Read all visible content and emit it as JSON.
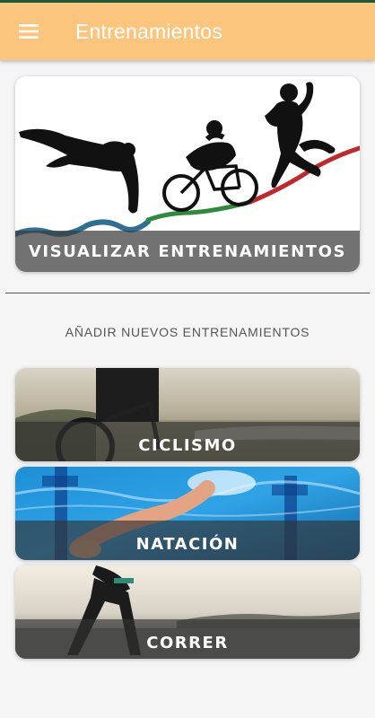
{
  "app": {
    "title": "Entrenamientos",
    "appbar_color": "#fbc57e",
    "menu_icon": "hamburger-menu-icon"
  },
  "hero": {
    "label": "Visualizar Entrenamientos",
    "image": "triathlon-silhouettes-swim-bike-run"
  },
  "section": {
    "title": "Añadir nuevos entrenamientos"
  },
  "sports": [
    {
      "label": "Ciclismo",
      "image": "cyclist-on-road-photo"
    },
    {
      "label": "Natación",
      "image": "swimmer-in-pool-photo"
    },
    {
      "label": "Correr",
      "image": "runner-at-sunset-photo"
    }
  ]
}
